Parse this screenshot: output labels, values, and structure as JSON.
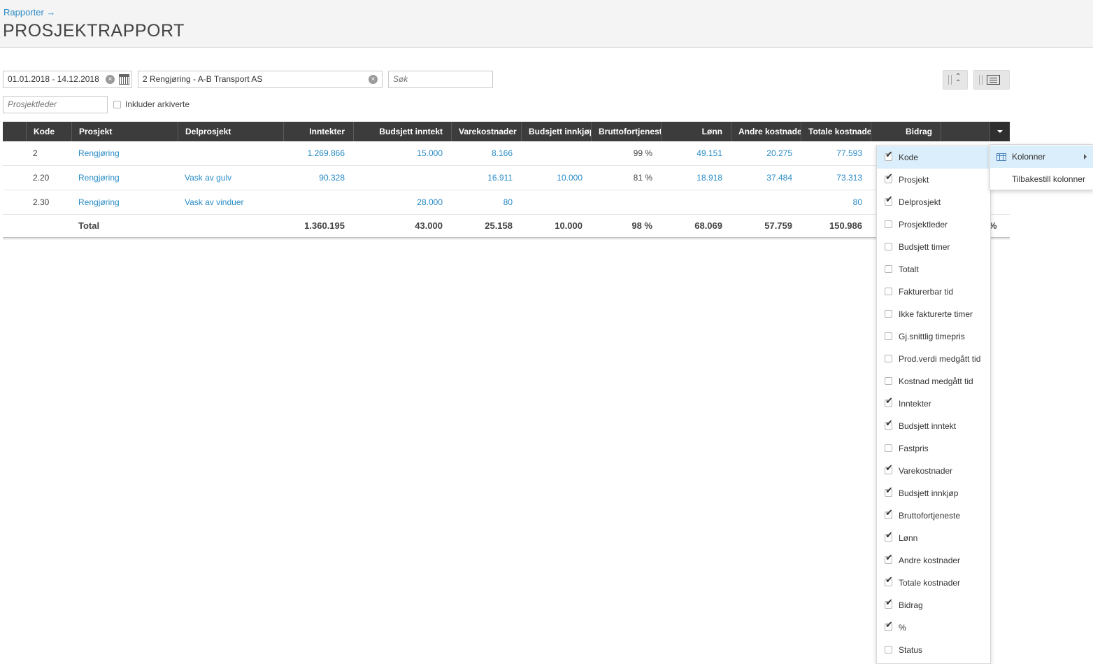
{
  "header": {
    "breadcrumb": "Rapporter →",
    "title": "PROSJEKTRAPPORT"
  },
  "filters": {
    "date_range": "01.01.2018 - 14.12.2018",
    "project": "2 Rengjøring - A-B Transport AS",
    "search_placeholder": "Søk",
    "manager_placeholder": "Prosjektleder",
    "include_archived": "Inkluder arkiverte"
  },
  "table": {
    "headers": {
      "kode": "Kode",
      "prosjekt": "Prosjekt",
      "delprosjekt": "Delprosjekt",
      "inntekter": "Inntekter",
      "budsjett_inntekt": "Budsjett inntekt",
      "varekostnader": "Varekostnader",
      "budsjett_innkjop": "Budsjett innkjøp",
      "bruttofortjeneste": "Bruttofortjeneste",
      "lonn": "Lønn",
      "andre_kostnader": "Andre kostnader",
      "totale_kostnader": "Totale kostnader",
      "bidrag": "Bidrag"
    },
    "rows": [
      {
        "kode": "2",
        "prosjekt": "Rengjøring",
        "delprosjekt": "",
        "inntekter": "1.269.866",
        "budsjett_inntekt": "15.000",
        "varekostnader": "8.166",
        "budsjett_innkjop": "",
        "bruttofortjeneste": "99 %",
        "lonn": "49.151",
        "andre_kostnader": "20.275",
        "totale_kostnader": "77.593"
      },
      {
        "kode": "2.20",
        "prosjekt": "Rengjøring",
        "delprosjekt": "Vask av gulv",
        "inntekter": "90.328",
        "budsjett_inntekt": "",
        "varekostnader": "16.911",
        "budsjett_innkjop": "10.000",
        "bruttofortjeneste": "81 %",
        "lonn": "18.918",
        "andre_kostnader": "37.484",
        "totale_kostnader": "73.313"
      },
      {
        "kode": "2.30",
        "prosjekt": "Rengjøring",
        "delprosjekt": "Vask av vinduer",
        "inntekter": "",
        "budsjett_inntekt": "28.000",
        "varekostnader": "80",
        "budsjett_innkjop": "",
        "bruttofortjeneste": "",
        "lonn": "",
        "andre_kostnader": "",
        "totale_kostnader": "80"
      }
    ],
    "total": {
      "label": "Total",
      "inntekter": "1.360.195",
      "budsjett_inntekt": "43.000",
      "varekostnader": "25.158",
      "budsjett_innkjop": "10.000",
      "bruttofortjeneste": "98 %",
      "lonn": "68.069",
      "andre_kostnader": "57.759",
      "totale_kostnader": "150.986",
      "percent_suffix": "%"
    }
  },
  "column_menu": {
    "items": [
      {
        "label": "Kode",
        "checked": true
      },
      {
        "label": "Prosjekt",
        "checked": true
      },
      {
        "label": "Delprosjekt",
        "checked": true
      },
      {
        "label": "Prosjektleder",
        "checked": false
      },
      {
        "label": "Budsjett timer",
        "checked": false
      },
      {
        "label": "Totalt",
        "checked": false
      },
      {
        "label": "Fakturerbar tid",
        "checked": false
      },
      {
        "label": "Ikke fakturerte timer",
        "checked": false
      },
      {
        "label": "Gj.snittlig timepris",
        "checked": false
      },
      {
        "label": "Prod.verdi medgått tid",
        "checked": false
      },
      {
        "label": "Kostnad medgått tid",
        "checked": false
      },
      {
        "label": "Inntekter",
        "checked": true
      },
      {
        "label": "Budsjett inntekt",
        "checked": true
      },
      {
        "label": "Fastpris",
        "checked": false
      },
      {
        "label": "Varekostnader",
        "checked": true
      },
      {
        "label": "Budsjett innkjøp",
        "checked": true
      },
      {
        "label": "Bruttofortjeneste",
        "checked": true
      },
      {
        "label": "Lønn",
        "checked": true
      },
      {
        "label": "Andre kostnader",
        "checked": true
      },
      {
        "label": "Totale kostnader",
        "checked": true
      },
      {
        "label": "Bidrag",
        "checked": true
      },
      {
        "label": "%",
        "checked": true
      },
      {
        "label": "Status",
        "checked": false
      }
    ]
  },
  "context_menu": {
    "columns_label": "Kolonner",
    "reset_label": "Tilbakestill kolonner"
  },
  "colors": {
    "link": "#2a8cc6",
    "header_bg": "#3c3c3c",
    "highlight": "#dbeefb"
  }
}
